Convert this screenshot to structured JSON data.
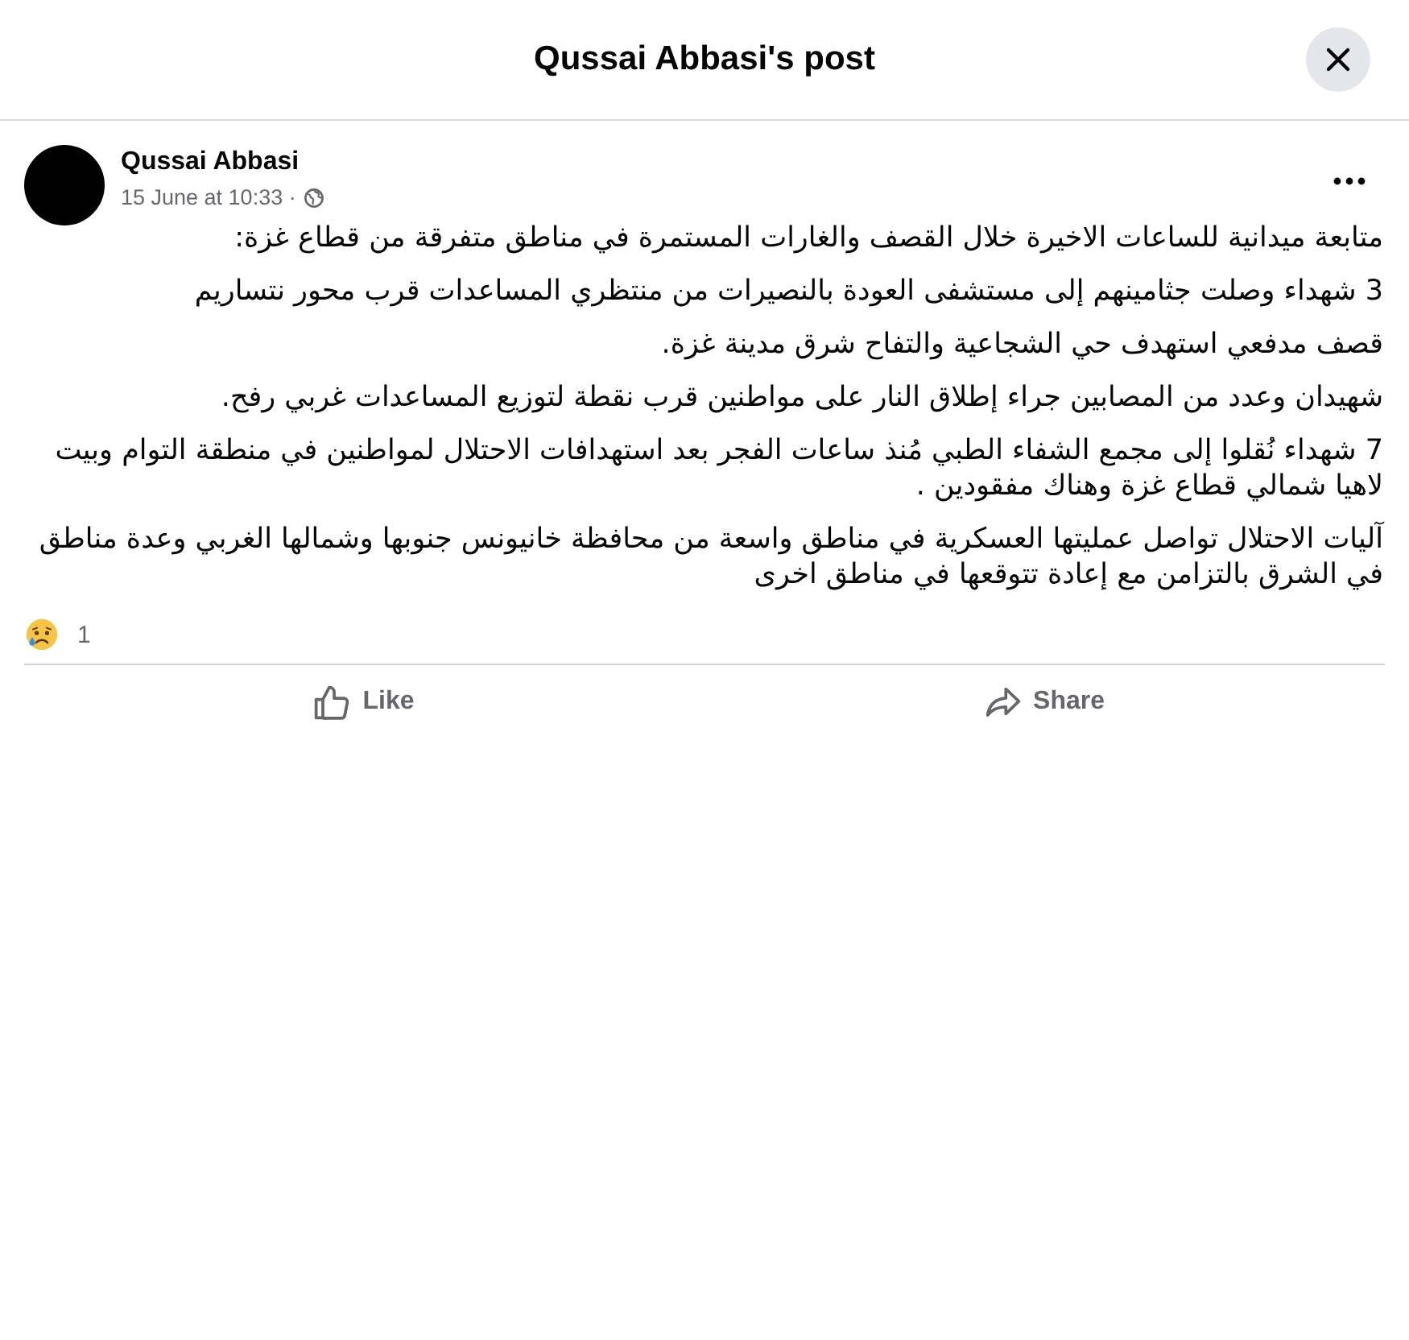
{
  "dialog": {
    "title": "Qussai Abbasi's post"
  },
  "post": {
    "author": "Qussai Abbasi",
    "timestamp": "15 June at 10:33 ·",
    "paragraphs": [
      "متابعة ميدانية للساعات الاخيرة خلال القصف والغارات المستمرة في مناطق متفرقة من قطاع غزة:",
      "3 شهداء وصلت جثامينهم إلى مستشفى العودة بالنصيرات من منتظري المساعدات قرب محور نتساريم",
      "قصف مدفعي استهدف حي الشجاعية والتفاح شرق مدينة غزة.",
      "شهيدان وعدد من المصابين جراء إطلاق النار على مواطنين قرب نقطة لتوزيع المساعدات غربي رفح.",
      "7 شهداء نُقلوا إلى مجمع الشفاء الطبي مُنذ ساعات الفجر بعد استهدافات الاحتلال لمواطنين في منطقة التوام وبيت لاهيا شمالي قطاع غزة وهناك مفقودين .",
      "آليات الاحتلال تواصل عمليتها العسكرية في مناطق واسعة من محافظة خانيونس جنوبها وشمالها الغربي وعدة مناطق في الشرق بالتزامن مع إعادة تتوقعها في مناطق اخرى"
    ]
  },
  "reactions": {
    "count": "1"
  },
  "action_bar": {
    "like": {
      "label": "Like"
    },
    "share": {
      "label": "Share"
    }
  }
}
